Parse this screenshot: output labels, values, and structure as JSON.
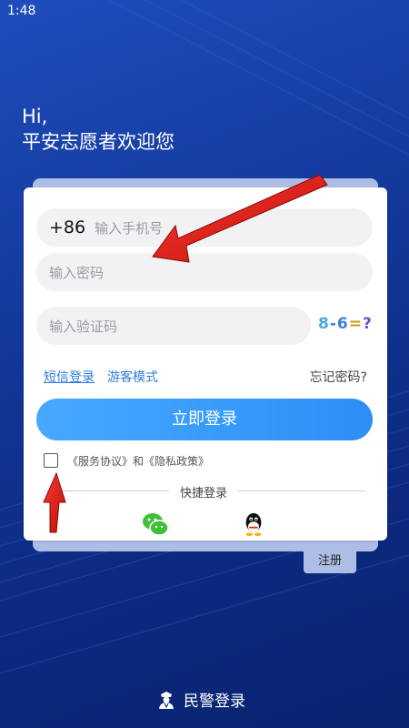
{
  "status": {
    "time": "1:48"
  },
  "greeting": {
    "line1": "Hi,",
    "line2": "平安志愿者欢迎您"
  },
  "form": {
    "country_code": "+86",
    "phone_placeholder": "输入手机号",
    "password_placeholder": "输入密码",
    "captcha_placeholder": "输入验证码",
    "captcha_text": [
      "8",
      "-",
      "6",
      "=",
      "?"
    ]
  },
  "links": {
    "sms_login": "短信登录",
    "guest_mode": "游客模式",
    "forgot_password": "忘记密码?"
  },
  "login_button": "立即登录",
  "agreement": "《服务协议》和《隐私政策》",
  "quick_login": {
    "label": "快捷登录",
    "icons": [
      "wechat-icon",
      "qq-icon"
    ]
  },
  "register_tab": "注册",
  "police_login": "民警登录",
  "colors": {
    "background": "#143a9e",
    "accent": "#2b8ff6",
    "arrow": "#e0201a"
  }
}
